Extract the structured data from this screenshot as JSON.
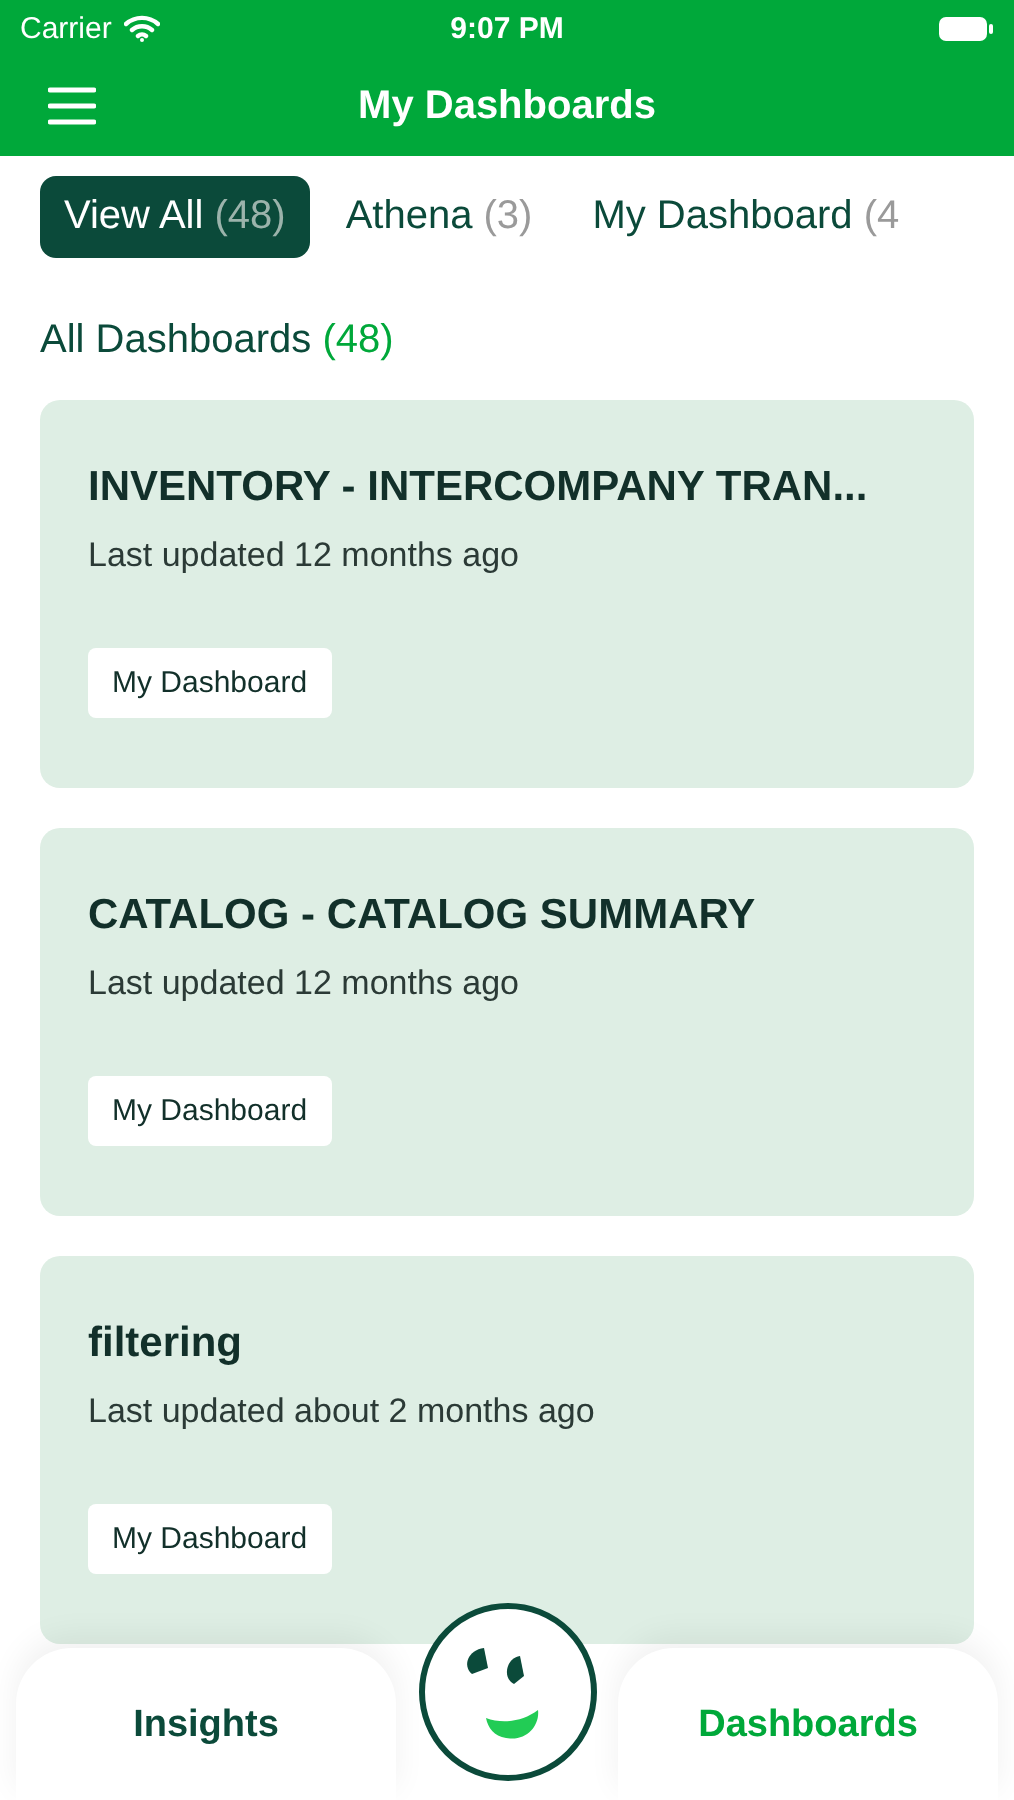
{
  "status_bar": {
    "carrier": "Carrier",
    "time": "9:07 PM"
  },
  "header": {
    "title": "My Dashboards"
  },
  "tabs": [
    {
      "label": "View All",
      "count": "(48)",
      "selected": true
    },
    {
      "label": "Athena",
      "count": "(3)",
      "selected": false
    },
    {
      "label": "My Dashboard",
      "count": "(4",
      "selected": false
    }
  ],
  "section": {
    "title": "All Dashboards",
    "count": "(48)"
  },
  "dashboards": [
    {
      "title": "INVENTORY - INTERCOMPANY TRAN...",
      "updated": "Last updated 12 months ago",
      "tag": "My Dashboard"
    },
    {
      "title": "CATALOG - CATALOG SUMMARY",
      "updated": "Last updated 12 months ago",
      "tag": "My Dashboard"
    },
    {
      "title": "filtering",
      "updated": "Last updated about 2 months ago",
      "tag": "My Dashboard"
    }
  ],
  "bottom_nav": [
    {
      "label": "Insights",
      "selected": false
    },
    {
      "label": "Dashboards",
      "selected": true
    }
  ]
}
